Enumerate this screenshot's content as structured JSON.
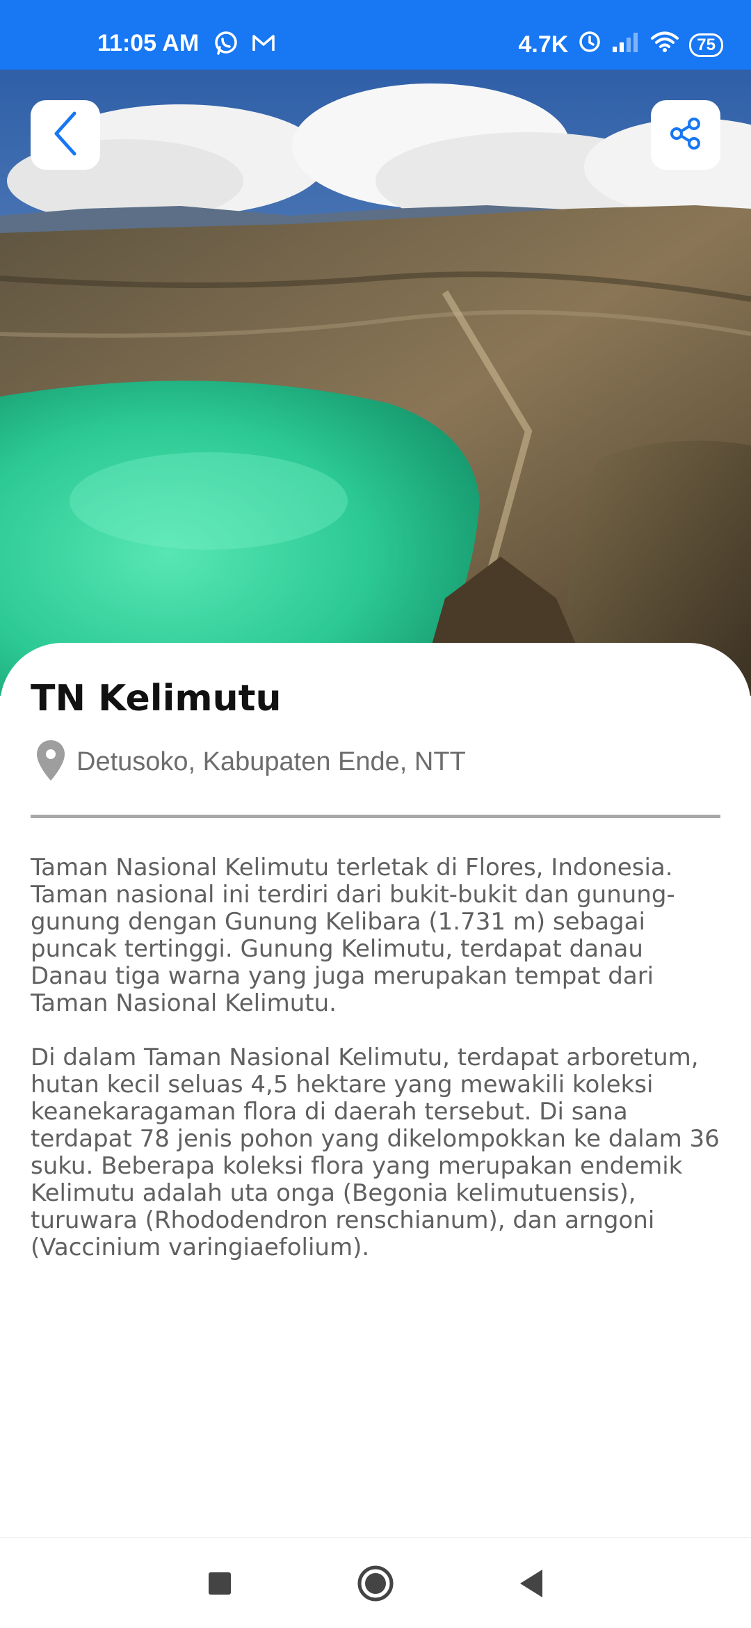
{
  "status_bar": {
    "time": "11:05 AM",
    "network_speed": "4.7K",
    "battery": "75",
    "notification_icons": [
      "whatsapp-icon",
      "gmail-icon"
    ],
    "system_icons": [
      "alarm-icon",
      "signal-icon",
      "wifi-icon",
      "battery-icon"
    ]
  },
  "colors": {
    "status_bar": "#1877f2",
    "accent": "#1877f2",
    "title": "#111111",
    "body_text": "#606060",
    "divider": "#a7a7a7"
  },
  "header": {
    "back_icon": "chevron-left-icon",
    "share_icon": "share-icon"
  },
  "detail": {
    "title": "TN Kelimutu",
    "location_icon": "location-pin-icon",
    "location": "Detusoko, Kabupaten Ende, NTT",
    "paragraphs": [
      "Taman Nasional Kelimutu terletak di Flores, Indonesia. Taman nasional ini terdiri dari bukit-bukit dan gunung-gunung dengan Gunung Kelibara (1.731 m) sebagai puncak tertinggi. Gunung Kelimutu, terdapat danau Danau tiga warna yang juga merupakan tempat dari Taman Nasional Kelimutu.",
      "Di dalam Taman Nasional Kelimutu, terdapat arboretum, hutan kecil seluas 4,5 hektare yang mewakili koleksi keanekaragaman flora di daerah tersebut. Di sana terdapat 78 jenis pohon yang dikelompokkan ke dalam 36 suku. Beberapa koleksi flora yang merupakan endemik Kelimutu adalah uta onga (Begonia kelimutuensis), turuwara (Rhododendron renschianum), dan arngoni (Vaccinium varingiaefolium)."
    ]
  },
  "nav_bar": {
    "icons": [
      "recent-apps-icon",
      "home-icon",
      "back-icon"
    ]
  }
}
